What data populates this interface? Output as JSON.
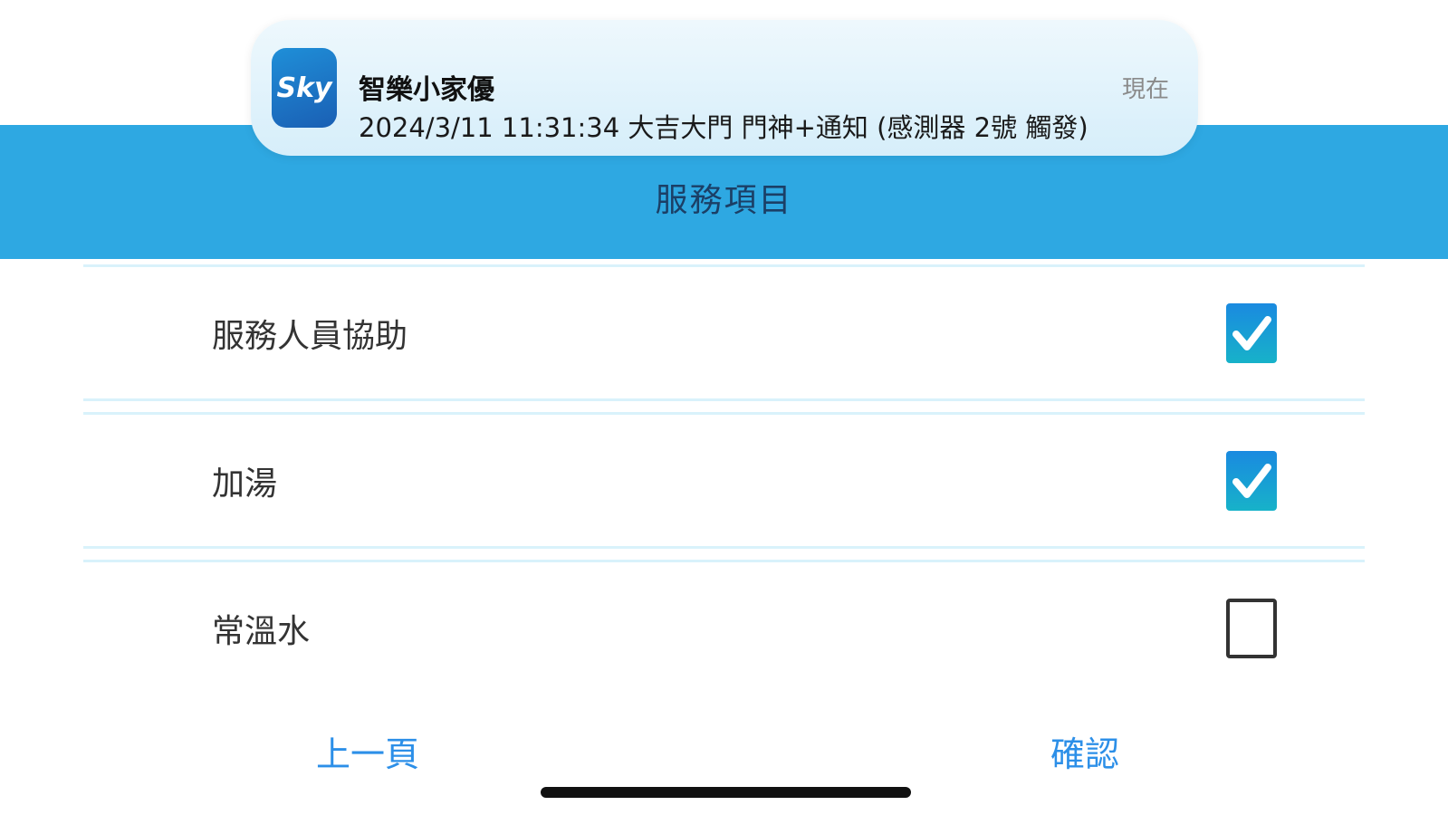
{
  "notification": {
    "app_name": "智樂小家優",
    "message": "2024/3/11 11:31:34 大吉大門 門神+通知 (感測器 2號 觸發)",
    "time": "現在",
    "icon": "sky-app-icon",
    "icon_text": "Sky"
  },
  "header": {
    "title": "服務項目",
    "background": "#2ea8e2"
  },
  "services": [
    {
      "label": "服務人員協助",
      "checked": true
    },
    {
      "label": "加湯",
      "checked": true
    },
    {
      "label": "常溫水",
      "checked": false
    }
  ],
  "footer": {
    "prev_label": "上一頁",
    "confirm_label": "確認"
  },
  "colors": {
    "accent": "#2c8fe8",
    "checkbox_fill": "#1a8ae0"
  }
}
